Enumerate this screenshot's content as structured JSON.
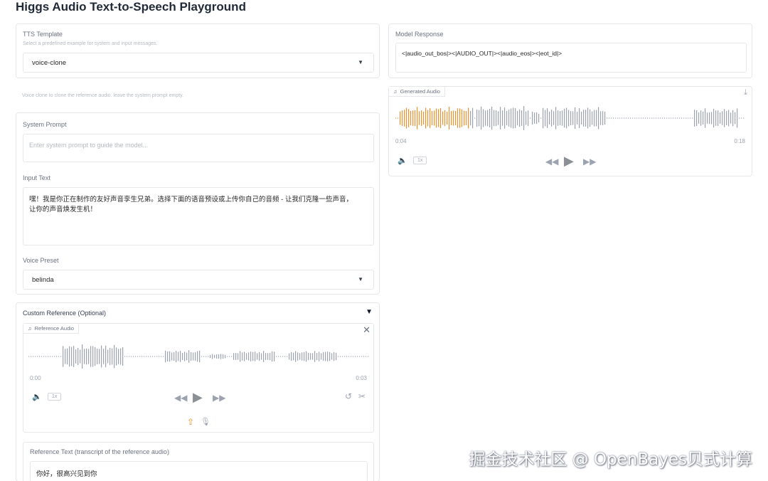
{
  "app": {
    "title": "Higgs Audio Text-to-Speech Playground"
  },
  "tts_template": {
    "label": "TTS Template",
    "hint": "Select a predefined example for system and input messages.",
    "value": "voice-clone"
  },
  "voice_clone_note": "Voice clone to clone the reference audio. leave the system prompt empty.",
  "system_prompt": {
    "label": "System Prompt",
    "placeholder": "Enter system prompt to guide the model..."
  },
  "input_text": {
    "label": "Input Text",
    "line1": "嘿！我是你正在制作的友好声音孪生兄弟。选择下面的语音预设或上传你自己的音频 - 让我们克隆一些声音，",
    "line2": "让你的声音焕发生机！"
  },
  "voice_preset": {
    "label": "Voice Preset",
    "value": "belinda"
  },
  "custom_reference": {
    "label": "Custom Reference (Optional)",
    "toggle": "▼",
    "audio_tag": "Reference Audio",
    "time_start": "0:00",
    "time_end": "0:03",
    "speed": "1x",
    "ref_text_label": "Reference Text (transcript of the reference audio)",
    "ref_text_value": "你好，很高兴见到你"
  },
  "model_response": {
    "label": "Model Response",
    "value": "<|audio_out_bos|><|AUDIO_OUT|><|audio_eos|><|eot_id|>"
  },
  "generated_audio": {
    "tag": "Generated Audio",
    "time_current": "0:04",
    "time_total": "0:18",
    "speed": "1x",
    "played_fraction": 0.21
  },
  "colors": {
    "played": "#e8912d",
    "unplayed": "#9ca3af",
    "border": "#e5e7eb"
  },
  "icons": [
    "music-note-icon",
    "download-icon",
    "volume-icon",
    "rewind-icon",
    "play-icon",
    "forward-icon",
    "close-icon",
    "undo-icon",
    "scissors-icon",
    "upload-icon",
    "microphone-icon"
  ],
  "watermark": "掘金技术社区 @ OpenBayes贝式计算"
}
